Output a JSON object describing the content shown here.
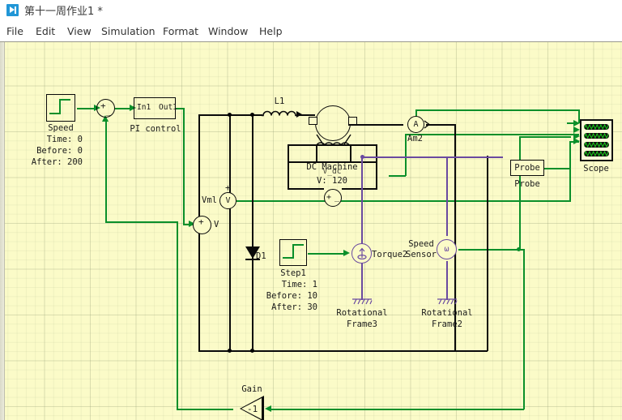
{
  "window": {
    "title": "第十一周作业1 *",
    "icon": "run-simulation-icon"
  },
  "menubar": {
    "items": [
      {
        "label": "File"
      },
      {
        "label": "Edit"
      },
      {
        "label": "View"
      },
      {
        "label": "Simulation"
      },
      {
        "label": "Format"
      },
      {
        "label": "Window"
      },
      {
        "label": "Help"
      }
    ]
  },
  "colors": {
    "canvas_background": "#fbfbc8",
    "signal_wire": "#0a8f2a",
    "electrical_wire": "#0a0a0a",
    "mechanical_wire": "#6a4aa0",
    "title_icon": "#2196d6"
  },
  "diagram": {
    "blocks": {
      "speed_step": {
        "name": "Speed",
        "time_label": "Time: 0",
        "before_label": "Before: 0",
        "after_label": "After: 200"
      },
      "sum": {
        "plus": "+",
        "minus": "_"
      },
      "pi_control": {
        "name": "PI control",
        "in_port": "In1",
        "out_port": "Out1"
      },
      "inductor": {
        "name": "L1"
      },
      "dc_machine": {
        "name": "DC Machine",
        "overlay_name": "V_dc",
        "value": "V: 120"
      },
      "ammeter": {
        "name": "Am2",
        "symbol": "A"
      },
      "voltmeter": {
        "name": "Vml",
        "symbol": "V",
        "polarity": "+"
      },
      "controlled_voltage_source": {
        "name": "V",
        "plus": "+",
        "minus": "_"
      },
      "dc_source": {
        "plus": "+",
        "minus": "_"
      },
      "diode": {
        "name": "D1"
      },
      "torque_step": {
        "name": "Step1",
        "time_label": "Time: 1",
        "before_label": "Before: 10",
        "after_label": "After: 30"
      },
      "torque_source": {
        "name": "Torque2"
      },
      "speed_sensor": {
        "name": "Speed Sensor",
        "name_line1": "Speed",
        "name_line2": "Sensor",
        "symbol": "ω"
      },
      "rotational_frame3": {
        "name_line1": "Rotational",
        "name_line2": "Frame3"
      },
      "rotational_frame2": {
        "name_line1": "Rotational",
        "name_line2": "Frame2"
      },
      "probe": {
        "inner_label": "Probe",
        "name": "Probe"
      },
      "scope": {
        "name": "Scope",
        "channels": 4
      },
      "gain": {
        "name": "Gain",
        "value": "-1"
      }
    }
  }
}
